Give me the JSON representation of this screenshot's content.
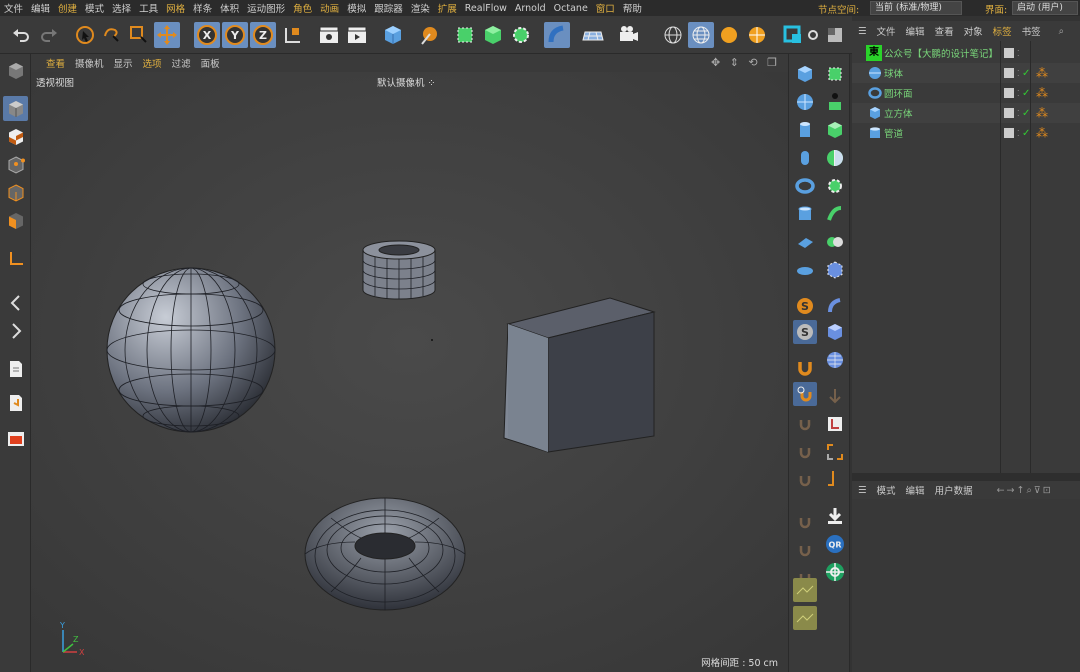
{
  "menubar": {
    "items": [
      "文件",
      "编辑",
      "创建",
      "模式",
      "选择",
      "工具",
      "网格",
      "样条",
      "体积",
      "运动图形",
      "角色",
      "动画",
      "模拟",
      "跟踪器",
      "渲染",
      "扩展",
      "RealFlow",
      "Arnold",
      "Octane",
      "窗口",
      "帮助"
    ],
    "node_space_label": "节点空间:",
    "node_space_value": "当前 (标准/物理)",
    "interface_label": "界面:",
    "interface_value": "启动 (用户)"
  },
  "viewport": {
    "menu": [
      "查看",
      "摄像机",
      "显示",
      "选项",
      "过滤",
      "面板"
    ],
    "view_name": "透视视图",
    "camera": "默认摄像机",
    "camera_icon": "camera-dots-icon",
    "grid_spacing": "网格间距 : 50 cm",
    "axis": {
      "x": "X",
      "y": "Y",
      "z": "Z"
    }
  },
  "object_manager": {
    "menu": [
      "文件",
      "编辑",
      "查看",
      "对象",
      "标签",
      "书签"
    ],
    "objects": [
      {
        "name": "公众号【大鹏的设计笔记】",
        "icon": "null-object-icon"
      },
      {
        "name": "球体",
        "icon": "sphere-icon"
      },
      {
        "name": "圆环面",
        "icon": "torus-icon"
      },
      {
        "name": "立方体",
        "icon": "cube-icon"
      },
      {
        "name": "管道",
        "icon": "tube-icon"
      }
    ]
  },
  "attribute_manager": {
    "menu": [
      "模式",
      "编辑",
      "用户数据"
    ]
  },
  "colors": {
    "accent": "#e0b040",
    "selection": "#6a8fc0",
    "object_name": "#79d57a",
    "background": "#3e3e3e"
  }
}
